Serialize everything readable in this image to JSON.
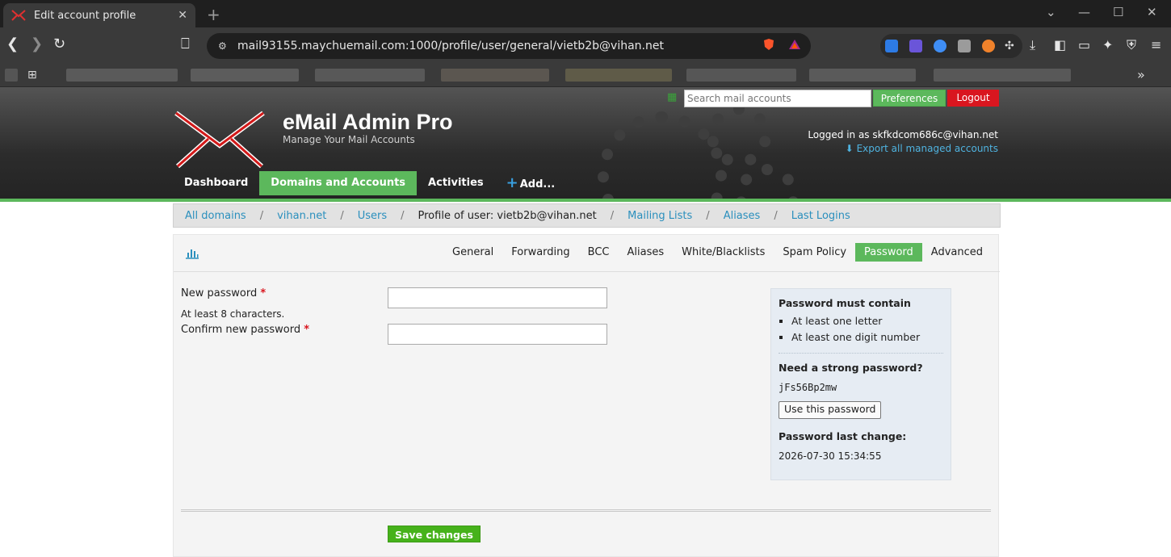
{
  "browser": {
    "tab_title": "Edit account profile",
    "tab_close": "✕",
    "new_tab": "+",
    "url": "mail93155.maychuemail.com:1000/profile/user/general/vietb2b@vihan.net",
    "more_bookmarks": "»"
  },
  "header": {
    "app_title": "eMail Admin Pro",
    "app_subtitle": "Manage Your Mail Accounts",
    "search_placeholder": "Search mail accounts",
    "preferences": "Preferences",
    "logout": "Logout",
    "logged_in": "Logged in as skfkdcom686c@vihan.net",
    "export_link": "Export all managed accounts"
  },
  "mainnav": {
    "items": [
      "Dashboard",
      "Domains and Accounts",
      "Activities",
      "Add..."
    ],
    "active_index": 1
  },
  "breadcrumb": {
    "all_domains": "All domains",
    "domain": "vihan.net",
    "users": "Users",
    "current": "Profile of user: vietb2b@vihan.net",
    "mailing_lists": "Mailing Lists",
    "aliases": "Aliases",
    "last_logins": "Last Logins",
    "separator": "/"
  },
  "subtabs": {
    "items": [
      "General",
      "Forwarding",
      "BCC",
      "Aliases",
      "White/Blacklists",
      "Spam Policy",
      "Password",
      "Advanced"
    ],
    "active": "Password"
  },
  "form": {
    "new_password_label": "New password",
    "required_mark": "*",
    "new_password_hint": "At least 8 characters.",
    "confirm_label": "Confirm new password",
    "new_password_value": "",
    "confirm_value": "",
    "save_button": "Save changes"
  },
  "sidebox": {
    "must_contain_title": "Password must contain",
    "rules": [
      "At least one letter",
      "At least one digit number"
    ],
    "strong_title": "Need a strong password?",
    "generated": "jFs56Bp2mw",
    "use_button": "Use this password",
    "last_change_title": "Password last change:",
    "last_change_value": "2026-07-30 15:34:55"
  },
  "colors": {
    "accent_green": "#5cb85c",
    "logout_red": "#d9161f",
    "link_blue": "#2a8fbd"
  }
}
